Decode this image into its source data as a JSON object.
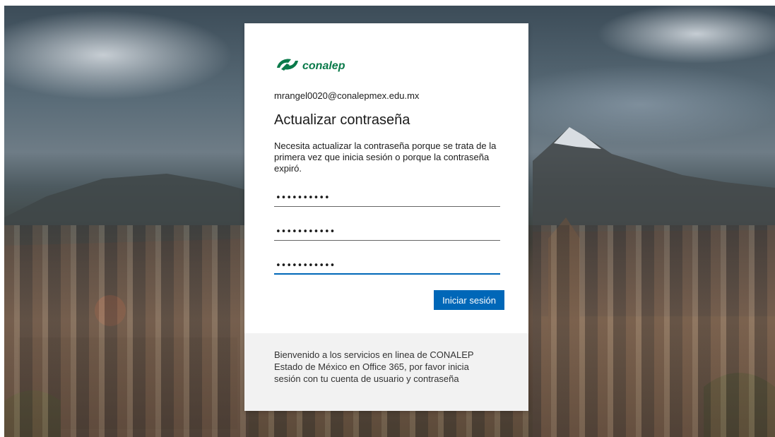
{
  "brand": {
    "logo_text": "conalep",
    "color": "#0a7a4a"
  },
  "identity": {
    "email": "mrangel0020@conalepmex.edu.mx"
  },
  "form": {
    "title": "Actualizar contraseña",
    "description": "Necesita actualizar la contraseña porque se trata de la primera vez que inicia sesión o porque la contraseña expiró.",
    "fields": [
      {
        "value": "••••••••••"
      },
      {
        "value": "•••••••••••"
      },
      {
        "value": "•••••••••••"
      }
    ],
    "submit_label": "Iniciar sesión",
    "accent_color": "#0067b8"
  },
  "footer": {
    "text": "Bienvenido a los servicios en linea de CONALEP Estado de México en Office 365, por favor inicia sesión con tu cuenta de usuario y contraseña"
  }
}
